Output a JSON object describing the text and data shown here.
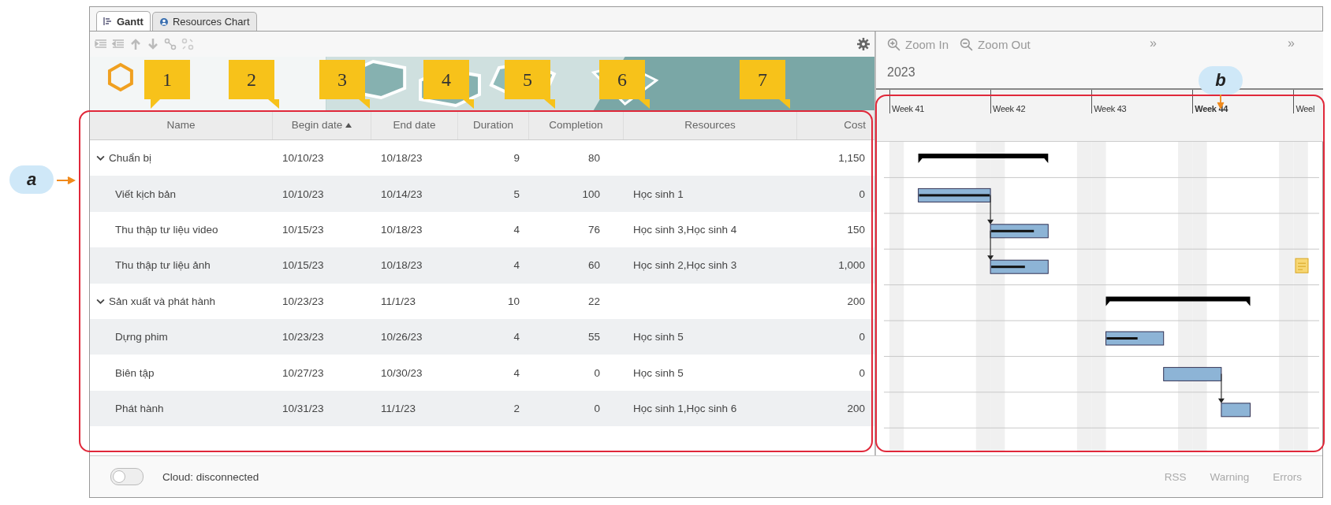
{
  "tabs": [
    {
      "label": "Gantt",
      "selected": true
    },
    {
      "label": "Resources Chart",
      "selected": false
    }
  ],
  "chart_toolbar": {
    "zoom_in": "Zoom In",
    "zoom_out": "Zoom Out",
    "more": [
      "»",
      "»"
    ]
  },
  "table": {
    "columns": [
      {
        "label": "Name",
        "sorted": false
      },
      {
        "label": "Begin date",
        "sorted": true
      },
      {
        "label": "End date",
        "sorted": false
      },
      {
        "label": "Duration",
        "sorted": false
      },
      {
        "label": "Completion",
        "sorted": false
      },
      {
        "label": "Resources",
        "sorted": false
      },
      {
        "label": "Cost",
        "sorted": false
      }
    ],
    "rows": [
      {
        "name": "Chuẩn bị",
        "begin": "10/10/23",
        "end": "10/18/23",
        "duration": "9",
        "completion": "80",
        "resources": "",
        "cost": "1,150",
        "expanded": true,
        "children": [
          {
            "name": "Viết kịch bản",
            "begin": "10/10/23",
            "end": "10/14/23",
            "duration": "5",
            "completion": "100",
            "resources": "Học sinh 1",
            "cost": "0",
            "linked": false,
            "note": false
          },
          {
            "name": "Thu thập tư liệu video",
            "begin": "10/15/23",
            "end": "10/18/23",
            "duration": "4",
            "completion": "76",
            "resources": "Học sinh 3,Học sinh 4",
            "cost": "150",
            "linked": true,
            "note": false
          },
          {
            "name": "Thu thập tư liệu ảnh",
            "begin": "10/15/23",
            "end": "10/18/23",
            "duration": "4",
            "completion": "60",
            "resources": "Học sinh 2,Học sinh 3",
            "cost": "1,000",
            "linked": true,
            "note": true
          }
        ]
      },
      {
        "name": "Sản xuất và phát hành",
        "begin": "10/23/23",
        "end": "11/1/23",
        "duration": "10",
        "completion": "22",
        "resources": "",
        "cost": "200",
        "expanded": true,
        "children": [
          {
            "name": "Dựng phim",
            "begin": "10/23/23",
            "end": "10/26/23",
            "duration": "4",
            "completion": "55",
            "resources": "Học sinh 5",
            "cost": "0",
            "linked": false,
            "note": false
          },
          {
            "name": "Biên tập",
            "begin": "10/27/23",
            "end": "10/30/23",
            "duration": "4",
            "completion": "0",
            "resources": "Học sinh 5",
            "cost": "0",
            "linked": false,
            "note": false
          },
          {
            "name": "Phát hành",
            "begin": "10/31/23",
            "end": "11/1/23",
            "duration": "2",
            "completion": "0",
            "resources": "Học sinh 1,Học sinh 6",
            "cost": "200",
            "linked": true,
            "note": false
          }
        ]
      }
    ]
  },
  "timeline": {
    "year": "2023",
    "weeks": [
      "Week 41",
      "Week 42",
      "Week 43",
      "Week 44",
      "Weel"
    ]
  },
  "status_bar": {
    "cloud_connected": false,
    "cloud": "Cloud: disconnected",
    "indicators": [
      "RSS",
      "Warning",
      "Errors"
    ]
  },
  "annotations": {
    "callouts": [
      "1",
      "2",
      "3",
      "4",
      "5",
      "6",
      "7"
    ],
    "labels": [
      "a",
      "b"
    ]
  }
}
